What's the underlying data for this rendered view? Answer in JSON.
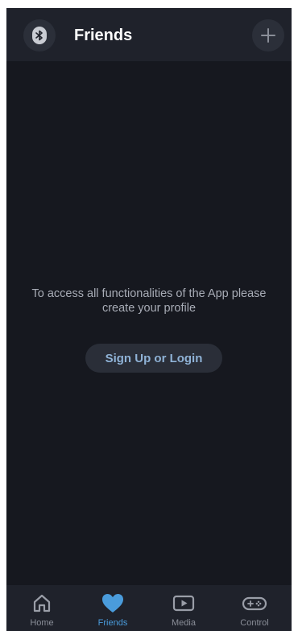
{
  "header": {
    "title": "Friends"
  },
  "icons": {
    "left": "bluetooth-icon",
    "right": "plus-icon"
  },
  "main": {
    "message": "To access all functionalities of the App please create your profile",
    "signup_label": "Sign Up or Login"
  },
  "nav": {
    "items": [
      {
        "label": "Home",
        "icon": "home-icon",
        "active": false
      },
      {
        "label": "Friends",
        "icon": "heart-icon",
        "active": true
      },
      {
        "label": "Media",
        "icon": "play-icon",
        "active": false
      },
      {
        "label": "Control",
        "icon": "gamepad-icon",
        "active": false
      }
    ]
  },
  "colors": {
    "background": "#16181f",
    "bar": "#1f222b",
    "accent": "#4a9cdc",
    "link": "#8fb2d6"
  }
}
